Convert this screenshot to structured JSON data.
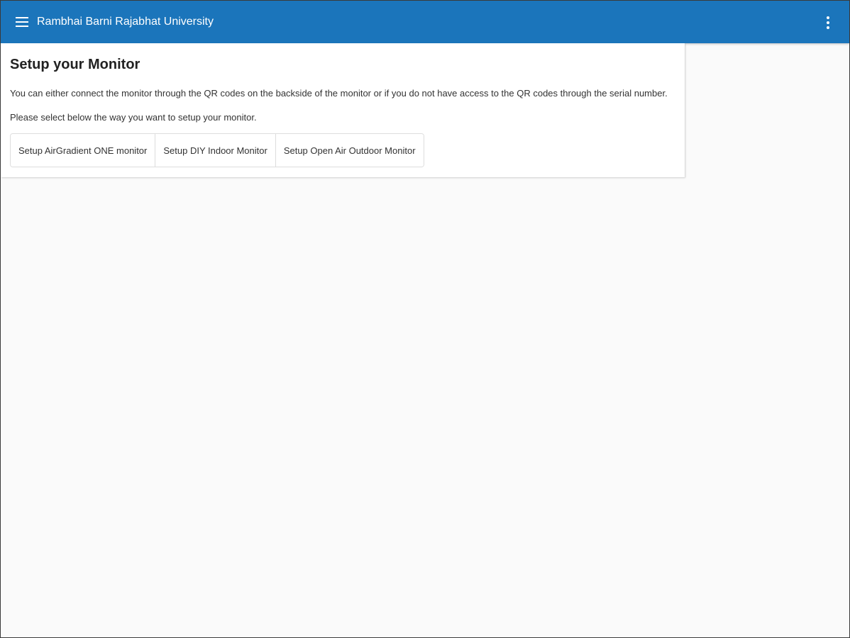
{
  "header": {
    "app_title": "Rambhai Barni Rajabhat University",
    "menu_icon": "hamburger-menu-icon",
    "more_icon": "more-vertical-icon",
    "background_color": "#1b75bb"
  },
  "main": {
    "title": "Setup your Monitor",
    "description": "You can either connect the monitor through the QR codes on the backside of the monitor or if you do not have access to the QR codes through the serial number.",
    "instruction": "Please select below the way you want to setup your monitor.",
    "options": [
      {
        "label": "Setup AirGradient ONE monitor"
      },
      {
        "label": "Setup DIY Indoor Monitor"
      },
      {
        "label": "Setup Open Air Outdoor Monitor"
      }
    ]
  }
}
